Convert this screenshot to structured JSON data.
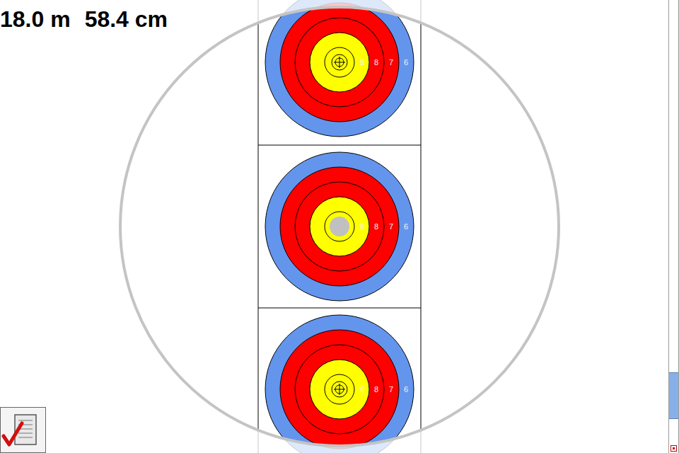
{
  "sight": {
    "distance": "18.0 m",
    "setting": "58.4 cm"
  },
  "targets": [
    {
      "rings": [
        "9",
        "8",
        "7",
        "6"
      ],
      "kind": "cross"
    },
    {
      "rings": [
        "9",
        "8",
        "7",
        "6"
      ],
      "kind": "dot"
    },
    {
      "rings": [
        "9",
        "8",
        "7",
        "6"
      ],
      "kind": "cross"
    }
  ],
  "scrollbar": {
    "position": 0.84,
    "size": 0.105
  }
}
